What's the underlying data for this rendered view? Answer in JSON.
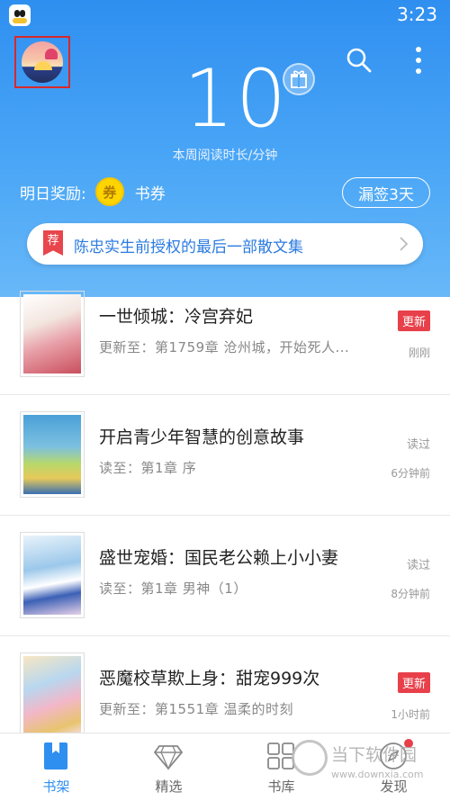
{
  "status_bar": {
    "time": "3:23",
    "app_icon": "qq-penguin-icon"
  },
  "header": {
    "avatar": "user-avatar",
    "reading_minutes": "10",
    "reading_label": "本周阅读时长/分钟",
    "reward_label": "明日奖励:",
    "coupon_badge": "券",
    "coupon_label": "书券",
    "missed_signin_button": "漏签3天",
    "colors": {
      "gradient_top": "#2f8ff0",
      "gradient_bottom": "#68b8f8"
    }
  },
  "promo": {
    "tag": "荐",
    "text": "陈忠实生前授权的最后一部散文集"
  },
  "books": [
    {
      "title": "一世倾城：冷宫弃妃",
      "subtitle": "更新至：第1759章 沧州城，开始死人...",
      "badge": "更新",
      "badge_type": "new",
      "time": "刚刚"
    },
    {
      "title": "开启青少年智慧的创意故事",
      "subtitle": "读至：第1章 序",
      "badge": "读过",
      "badge_type": "read",
      "time": "6分钟前"
    },
    {
      "title": "盛世宠婚：国民老公赖上小小妻",
      "subtitle": "读至：第1章 男神（1）",
      "badge": "读过",
      "badge_type": "read",
      "time": "8分钟前"
    },
    {
      "title": "恶魔校草欺上身：甜宠999次",
      "subtitle": "更新至：第1551章 温柔的时刻",
      "badge": "更新",
      "badge_type": "new",
      "time": "1小时前"
    }
  ],
  "tabs": [
    {
      "label": "书架",
      "icon": "bookshelf-icon",
      "active": true
    },
    {
      "label": "精选",
      "icon": "diamond-icon",
      "active": false
    },
    {
      "label": "书库",
      "icon": "grid-icon",
      "active": false
    },
    {
      "label": "发现",
      "icon": "compass-icon",
      "active": false
    }
  ],
  "watermark": {
    "text": "当下软件园",
    "url": "www.downxia.com"
  },
  "accent_color": "#2f8ff0",
  "badge_color": "#e8404a"
}
